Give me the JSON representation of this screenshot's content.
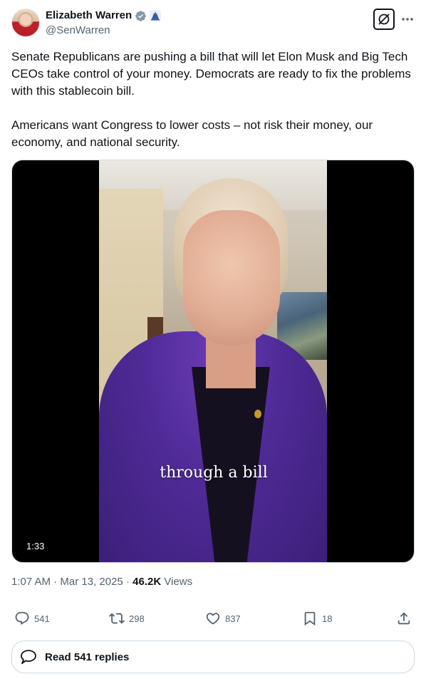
{
  "author": {
    "display_name": "Elizabeth Warren",
    "handle": "@SenWarren",
    "verified_color": "#829aab",
    "affiliate_badge_color": "#3b5aa8"
  },
  "tweet": {
    "paragraphs": [
      "Senate Republicans are pushing a bill that will let Elon Musk and Big Tech CEOs take control of your money. Democrats are ready to fix the problems with this stablecoin bill.",
      "Americans want Congress to lower costs – not risk their money, our economy, and national security."
    ]
  },
  "media": {
    "caption": "through a bill",
    "duration": "1:33"
  },
  "meta": {
    "time": "1:07 AM",
    "separator1": "·",
    "date": "Mar 13, 2025",
    "separator2": "·",
    "views_count": "46.2K",
    "views_label": "Views"
  },
  "actions": {
    "replies": "541",
    "reposts": "298",
    "likes": "837",
    "bookmarks": "18"
  },
  "read_replies": {
    "label": "Read 541 replies"
  },
  "icons": [
    "grok-icon",
    "more-icon",
    "verified-badge-icon",
    "affiliate-badge-icon",
    "reply-icon",
    "repost-icon",
    "like-icon",
    "bookmark-icon",
    "share-icon",
    "replies-bubble-icon"
  ],
  "colors": {
    "text_primary": "#0f1419",
    "text_secondary": "#536471",
    "border": "#cfd9de"
  }
}
